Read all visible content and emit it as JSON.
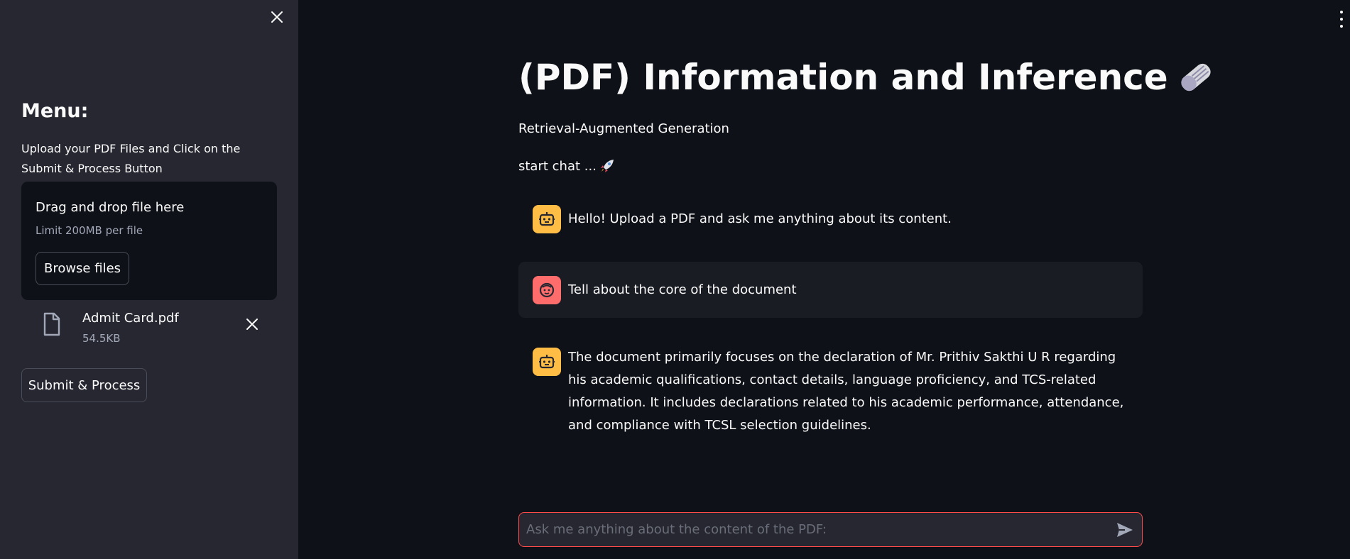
{
  "sidebar": {
    "menu_title": "Menu:",
    "description": "Upload your PDF Files and Click on the Submit & Process Button",
    "dropzone": {
      "title": "Drag and drop file here",
      "limit": "Limit 200MB per file",
      "browse_label": "Browse files"
    },
    "file": {
      "name": "Admit Card.pdf",
      "size": "54.5KB"
    },
    "submit_label": "Submit & Process"
  },
  "main": {
    "title": "(PDF) Information and Inference",
    "title_icon": "newspaper-icon",
    "subtitle": "Retrieval-Augmented Generation",
    "start_chat": "start chat ...",
    "start_chat_icon": "rocket-icon",
    "messages": [
      {
        "role": "assistant",
        "text": "Hello! Upload a PDF and ask me anything about its content."
      },
      {
        "role": "user",
        "text": "Tell about the core of the document"
      },
      {
        "role": "assistant",
        "text": "The document primarily focuses on the declaration of Mr. Prithiv Sakthi U R regarding his academic qualifications, contact details, language proficiency, and TCS-related information. It includes declarations related to his academic performance, attendance, and compliance with TCSL selection guidelines."
      }
    ],
    "chat_input": {
      "placeholder": "Ask me anything about the content of the PDF:",
      "value": ""
    }
  },
  "colors": {
    "background": "#0e1117",
    "sidebar": "#262730",
    "accent": "#ff4b4b",
    "bot_avatar": "#ffbd45",
    "user_avatar": "#ff6c6c"
  }
}
